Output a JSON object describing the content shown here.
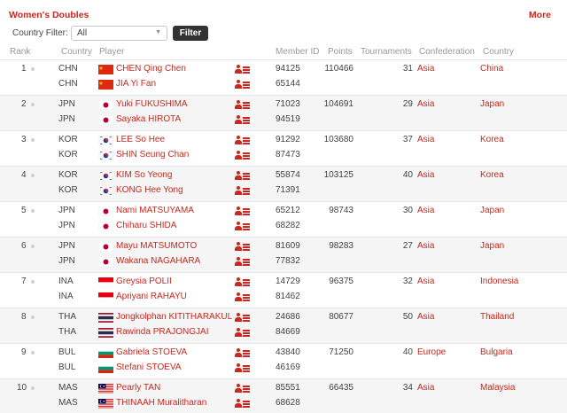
{
  "header": {
    "title": "Women's Doubles",
    "more_label": "More"
  },
  "filter": {
    "label": "Country Filter:",
    "value": "All",
    "button_label": "Filter"
  },
  "columns": {
    "rank": "Rank",
    "country": "Country",
    "player": "Player",
    "member_id": "Member ID",
    "points": "Points",
    "tournaments": "Tournaments",
    "confederation": "Confederation",
    "country_name": "Country"
  },
  "rows": [
    {
      "rank": "1",
      "points": "110466",
      "tournaments": "31",
      "confederation": "Asia",
      "country_name": "China",
      "players": [
        {
          "code": "CHN",
          "flag": "china-flag-icon",
          "name": "CHEN Qing Chen",
          "member_id": "94125"
        },
        {
          "code": "CHN",
          "flag": "china-flag-icon",
          "name": "JIA Yi Fan",
          "member_id": "65144"
        }
      ]
    },
    {
      "rank": "2",
      "points": "104691",
      "tournaments": "29",
      "confederation": "Asia",
      "country_name": "Japan",
      "players": [
        {
          "code": "JPN",
          "flag": "japan-flag-icon",
          "name": "Yuki FUKUSHIMA",
          "member_id": "71023"
        },
        {
          "code": "JPN",
          "flag": "japan-flag-icon",
          "name": "Sayaka HIROTA",
          "member_id": "94519"
        }
      ]
    },
    {
      "rank": "3",
      "points": "103680",
      "tournaments": "37",
      "confederation": "Asia",
      "country_name": "Korea",
      "players": [
        {
          "code": "KOR",
          "flag": "korea-flag-icon",
          "name": "LEE So Hee",
          "member_id": "91292"
        },
        {
          "code": "KOR",
          "flag": "korea-flag-icon",
          "name": "SHIN Seung Chan",
          "member_id": "87473"
        }
      ]
    },
    {
      "rank": "4",
      "points": "103125",
      "tournaments": "40",
      "confederation": "Asia",
      "country_name": "Korea",
      "players": [
        {
          "code": "KOR",
          "flag": "korea-flag-icon",
          "name": "KIM So Yeong",
          "member_id": "55874"
        },
        {
          "code": "KOR",
          "flag": "korea-flag-icon",
          "name": "KONG Hee Yong",
          "member_id": "71391"
        }
      ]
    },
    {
      "rank": "5",
      "points": "98743",
      "tournaments": "30",
      "confederation": "Asia",
      "country_name": "Japan",
      "players": [
        {
          "code": "JPN",
          "flag": "japan-flag-icon",
          "name": "Nami MATSUYAMA",
          "member_id": "65212"
        },
        {
          "code": "JPN",
          "flag": "japan-flag-icon",
          "name": "Chiharu SHIDA",
          "member_id": "68282"
        }
      ]
    },
    {
      "rank": "6",
      "points": "98283",
      "tournaments": "27",
      "confederation": "Asia",
      "country_name": "Japan",
      "players": [
        {
          "code": "JPN",
          "flag": "japan-flag-icon",
          "name": "Mayu MATSUMOTO",
          "member_id": "81609"
        },
        {
          "code": "JPN",
          "flag": "japan-flag-icon",
          "name": "Wakana NAGAHARA",
          "member_id": "77832"
        }
      ]
    },
    {
      "rank": "7",
      "points": "96375",
      "tournaments": "32",
      "confederation": "Asia",
      "country_name": "Indonesia",
      "players": [
        {
          "code": "INA",
          "flag": "indonesia-flag-icon",
          "name": "Greysia POLII",
          "member_id": "14729"
        },
        {
          "code": "INA",
          "flag": "indonesia-flag-icon",
          "name": "Apriyani RAHAYU",
          "member_id": "81462"
        }
      ]
    },
    {
      "rank": "8",
      "points": "80677",
      "tournaments": "50",
      "confederation": "Asia",
      "country_name": "Thailand",
      "players": [
        {
          "code": "THA",
          "flag": "thailand-flag-icon",
          "name": "Jongkolphan KITITHARAKUL",
          "member_id": "24686"
        },
        {
          "code": "THA",
          "flag": "thailand-flag-icon",
          "name": "Rawinda PRAJONGJAI",
          "member_id": "84669"
        }
      ]
    },
    {
      "rank": "9",
      "points": "71250",
      "tournaments": "40",
      "confederation": "Europe",
      "country_name": "Bulgaria",
      "players": [
        {
          "code": "BUL",
          "flag": "bulgaria-flag-icon",
          "name": "Gabriela STOEVA",
          "member_id": "43840"
        },
        {
          "code": "BUL",
          "flag": "bulgaria-flag-icon",
          "name": "Stefani STOEVA",
          "member_id": "46169"
        }
      ]
    },
    {
      "rank": "10",
      "points": "66435",
      "tournaments": "34",
      "confederation": "Asia",
      "country_name": "Malaysia",
      "players": [
        {
          "code": "MAS",
          "flag": "malaysia-flag-icon",
          "name": "Pearly TAN",
          "member_id": "85551"
        },
        {
          "code": "MAS",
          "flag": "malaysia-flag-icon",
          "name": "THINAAH Muralitharan",
          "member_id": "68628"
        }
      ]
    }
  ],
  "colors": {
    "accent": "#c8281e",
    "alt_row": "#f5f5f5",
    "button": "#333333"
  }
}
